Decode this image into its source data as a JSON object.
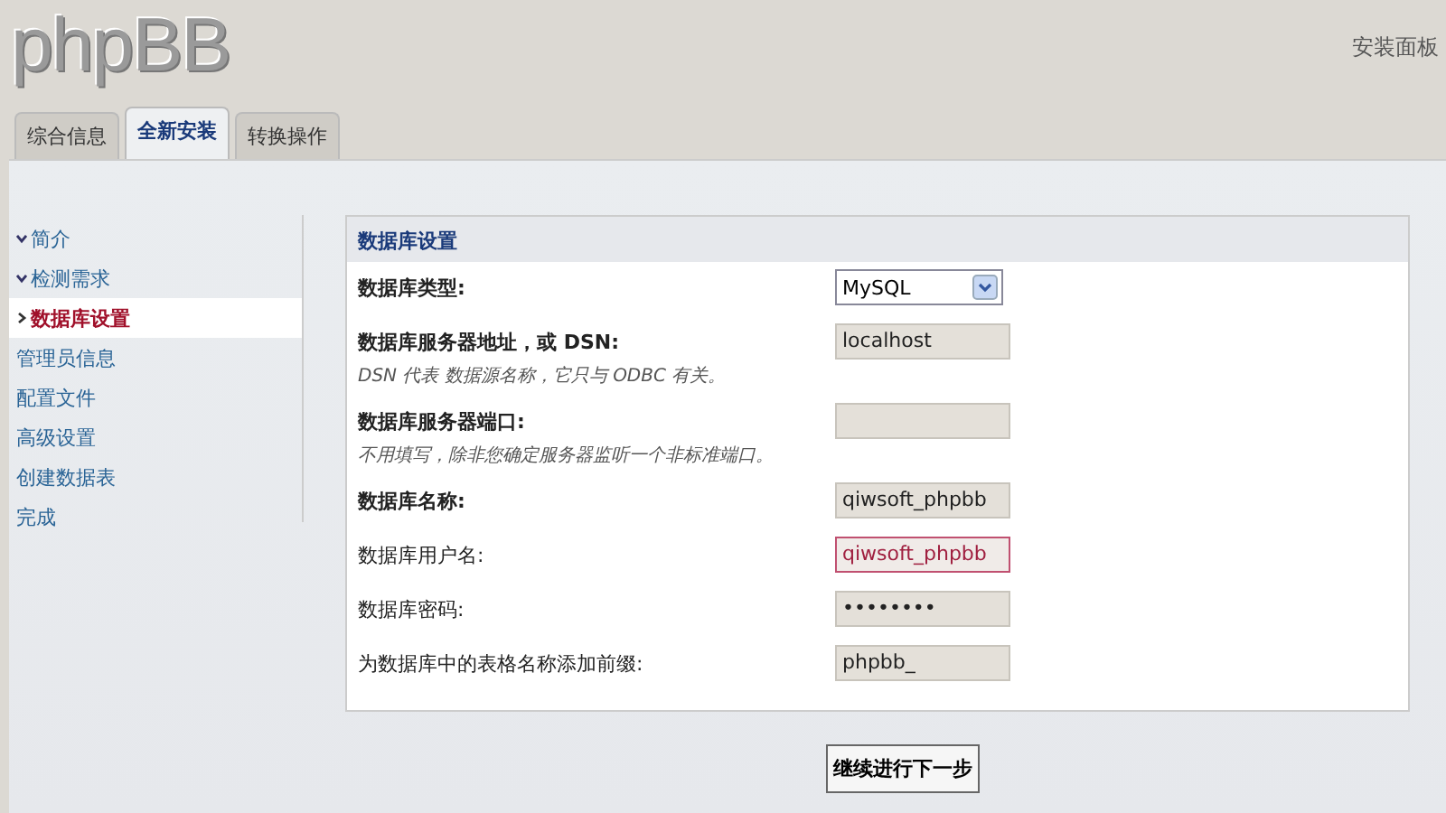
{
  "header": {
    "logo": "phpBB",
    "title": "安装面板"
  },
  "tabs": [
    {
      "label": "综合信息",
      "selected": false
    },
    {
      "label": "全新安装",
      "selected": true
    },
    {
      "label": "转换操作",
      "selected": false
    }
  ],
  "sidebar": {
    "items": [
      {
        "label": "简介",
        "completed": true,
        "selected": false
      },
      {
        "label": "检测需求",
        "completed": true,
        "selected": false
      },
      {
        "label": "数据库设置",
        "completed": false,
        "selected": true
      },
      {
        "label": "管理员信息",
        "completed": false,
        "selected": false
      },
      {
        "label": "配置文件",
        "completed": false,
        "selected": false
      },
      {
        "label": "高级设置",
        "completed": false,
        "selected": false
      },
      {
        "label": "创建数据表",
        "completed": false,
        "selected": false
      },
      {
        "label": "完成",
        "completed": false,
        "selected": false
      }
    ]
  },
  "form": {
    "legend": "数据库设置",
    "rows": [
      {
        "kind": "select",
        "label": "数据库类型:",
        "bold": true,
        "value": "MySQL",
        "focused": false
      },
      {
        "kind": "text",
        "label": "数据库服务器地址，或 DSN:",
        "hint": "DSN 代表 数据源名称，它只与 ODBC 有关。",
        "bold": true,
        "value": "localhost",
        "focused": false
      },
      {
        "kind": "text",
        "label": "数据库服务器端口:",
        "hint": "不用填写，除非您确定服务器监听一个非标准端口。",
        "bold": true,
        "focused": false
      },
      {
        "kind": "text",
        "label": "数据库名称:",
        "bold": true,
        "value": "qiwsoft_phpbb",
        "focused": false
      },
      {
        "kind": "text",
        "label": "数据库用户名:",
        "bold": false,
        "value": "qiwsoft_phpbb",
        "focused": true
      },
      {
        "kind": "password",
        "label": "数据库密码:",
        "bold": false,
        "value": "••••••••",
        "focused": false
      },
      {
        "kind": "text",
        "label": "为数据库中的表格名称添加前缀:",
        "bold": false,
        "value": "phpbb_",
        "focused": false
      }
    ],
    "submit": "继续进行下一步"
  }
}
